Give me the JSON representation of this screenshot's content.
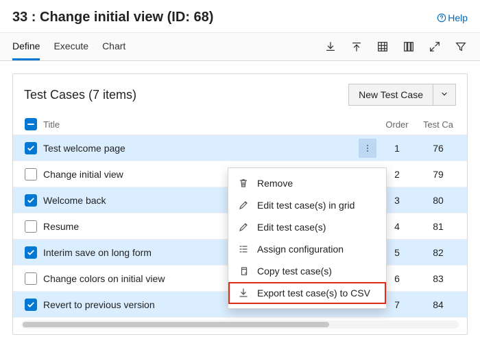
{
  "header": {
    "title": "33 : Change initial view (ID: 68)",
    "help": "Help"
  },
  "tabs": {
    "define": "Define",
    "execute": "Execute",
    "chart": "Chart",
    "active": "define"
  },
  "card": {
    "title": "Test Cases (7 items)",
    "new_label": "New Test Case",
    "columns": {
      "title": "Title",
      "order": "Order",
      "testcase": "Test Ca"
    }
  },
  "rows": [
    {
      "checked": true,
      "title": "Test welcome page",
      "order": "1",
      "id": "76",
      "active": true
    },
    {
      "checked": false,
      "title": "Change initial view",
      "order": "2",
      "id": "79"
    },
    {
      "checked": true,
      "title": "Welcome back",
      "order": "3",
      "id": "80"
    },
    {
      "checked": false,
      "title": "Resume",
      "order": "4",
      "id": "81"
    },
    {
      "checked": true,
      "title": "Interim save on long form",
      "order": "5",
      "id": "82"
    },
    {
      "checked": false,
      "title": "Change colors on initial view",
      "order": "6",
      "id": "83"
    },
    {
      "checked": true,
      "title": "Revert to previous version",
      "order": "7",
      "id": "84"
    }
  ],
  "menu": {
    "remove": "Remove",
    "edit_grid": "Edit test case(s) in grid",
    "edit": "Edit test case(s)",
    "assign": "Assign configuration",
    "copy": "Copy test case(s)",
    "export": "Export test case(s) to CSV"
  }
}
